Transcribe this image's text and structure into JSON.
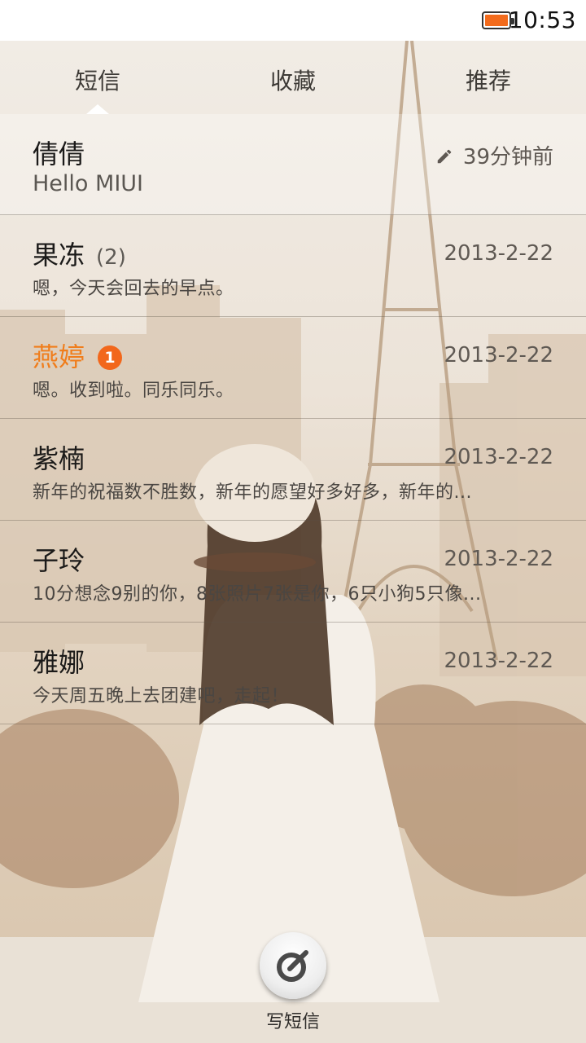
{
  "status_bar": {
    "time": "10:53",
    "battery_color": "#f36b1c"
  },
  "tabs": [
    {
      "label": "短信",
      "selected": true
    },
    {
      "label": "收藏",
      "selected": false
    },
    {
      "label": "推荐",
      "selected": false
    }
  ],
  "conversations": [
    {
      "name": "倩倩",
      "time": "39分钟前",
      "preview": "Hello MIUI",
      "draft": true,
      "icon": "pencil-icon"
    },
    {
      "name": "果冻",
      "count": "(2)",
      "time": "2013-2-22",
      "preview": "嗯，今天会回去的早点。"
    },
    {
      "name": "燕婷",
      "badge": "1",
      "unread": true,
      "time": "2013-2-22",
      "preview": "嗯。收到啦。同乐同乐。"
    },
    {
      "name": "紫楠",
      "time": "2013-2-22",
      "preview": "新年的祝福数不胜数，新年的愿望好多好多，新年的..."
    },
    {
      "name": "子玲",
      "time": "2013-2-22",
      "preview": "10分想念9别的你，8张照片7张是你，6只小狗5只像..."
    },
    {
      "name": "雅娜",
      "time": "2013-2-22",
      "preview": "今天周五晚上去团建吧，走起！"
    }
  ],
  "compose": {
    "label": "写短信",
    "icon": "compose-icon"
  },
  "colors": {
    "unread_name": "#f07d1b",
    "badge": "#f2671b"
  }
}
